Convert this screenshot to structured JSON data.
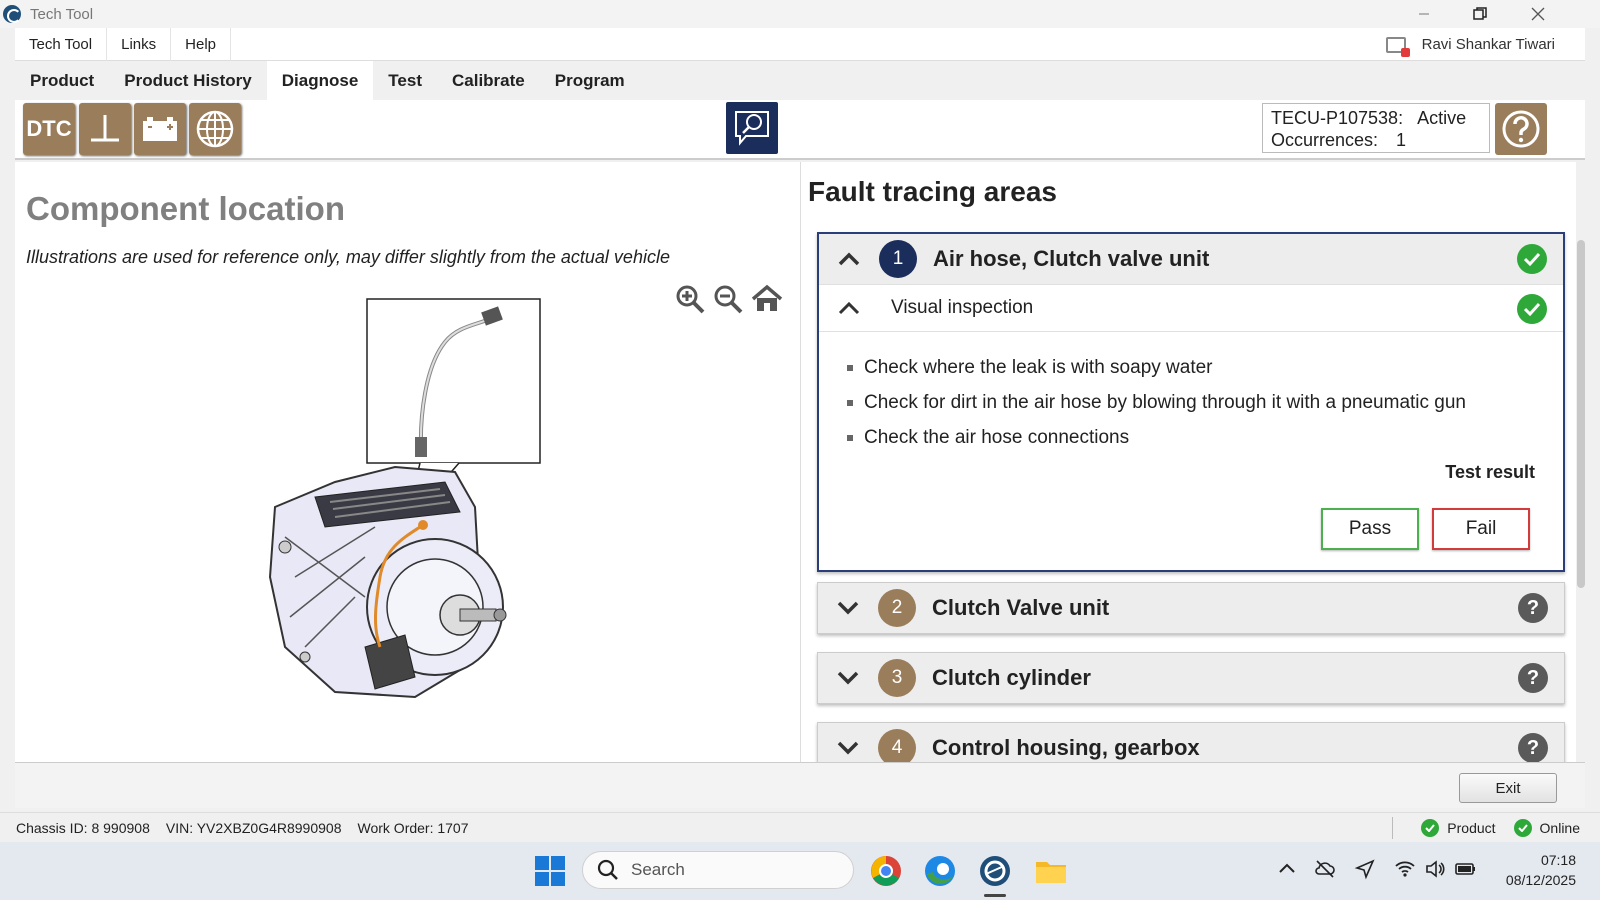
{
  "window": {
    "title": "Tech Tool"
  },
  "menu": {
    "items": [
      "Tech Tool",
      "Links",
      "Help"
    ],
    "user": "Ravi Shankar Tiwari"
  },
  "tabs": [
    {
      "label": "Product",
      "active": false
    },
    {
      "label": "Product History",
      "active": false
    },
    {
      "label": "Diagnose",
      "active": true
    },
    {
      "label": "Test",
      "active": false
    },
    {
      "label": "Calibrate",
      "active": false
    },
    {
      "label": "Program",
      "active": false
    }
  ],
  "toolbar": {
    "dtc_label": "DTC",
    "dtc_code": "TECU-P107538:",
    "dtc_status": "Active",
    "occurrences_label": "Occurrences:",
    "occurrences_value": "1",
    "accent": "#9a7d5a",
    "navy": "#1a2d5b"
  },
  "left": {
    "title": "Component location",
    "note": "Illustrations are used for reference only, may differ slightly from the actual vehicle"
  },
  "right": {
    "title": "Fault tracing areas",
    "areas": [
      {
        "num": "1",
        "label": "Air hose, Clutch valve unit",
        "status": "passed",
        "expanded": true
      },
      {
        "num": "2",
        "label": "Clutch Valve unit",
        "status": "unknown",
        "expanded": false
      },
      {
        "num": "3",
        "label": "Clutch cylinder",
        "status": "unknown",
        "expanded": false
      },
      {
        "num": "4",
        "label": "Control housing, gearbox",
        "status": "unknown",
        "expanded": false
      }
    ],
    "sub": {
      "label": "Visual inspection"
    },
    "steps": [
      "Check where the leak is with soapy water",
      "Check for dirt in the air hose by blowing through it with a pneumatic gun",
      "Check the air hose connections"
    ],
    "result_title": "Test result",
    "pass_label": "Pass",
    "fail_label": "Fail"
  },
  "bottom": {
    "exit_label": "Exit"
  },
  "status": {
    "chassis": "Chassis ID: 8 990908",
    "vin": "VIN: YV2XBZ0G4R8990908",
    "work_order": "Work Order: 1707",
    "product": "Product",
    "online": "Online"
  },
  "taskbar": {
    "search": "Search",
    "time": "07:18",
    "date": "08/12/2025"
  }
}
